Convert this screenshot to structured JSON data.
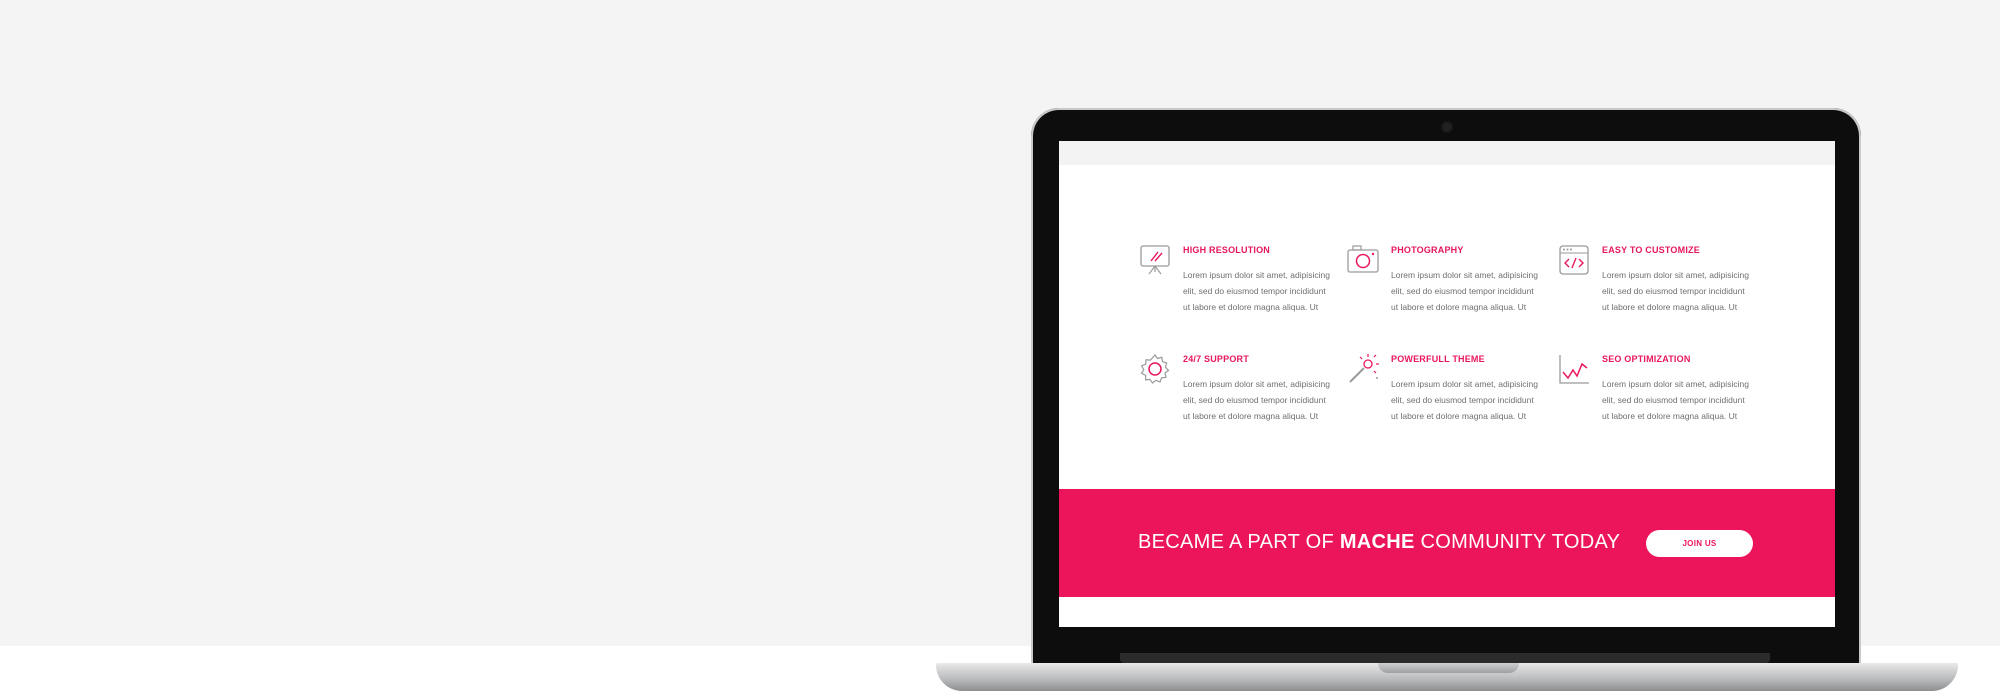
{
  "features": [
    {
      "title": "HIGH RESOLUTION",
      "desc": "Lorem ipsum dolor sit amet,  adipisicing elit, sed do eiusmod tempor incididunt ut labore et dolore magna aliqua. Ut",
      "icon": "presentation-board-icon"
    },
    {
      "title": "PHOTOGRAPHY",
      "desc": "Lorem ipsum dolor sit amet,  adipisicing elit, sed do eiusmod tempor incididunt ut labore et dolore magna aliqua. Ut",
      "icon": "camera-icon"
    },
    {
      "title": "EASY TO CUSTOMIZE",
      "desc": "Lorem ipsum dolor sit amet,  adipisicing elit, sed do eiusmod tempor incididunt ut labore et dolore magna aliqua. Ut",
      "icon": "code-window-icon"
    },
    {
      "title": "24/7 SUPPORT",
      "desc": "Lorem ipsum dolor sit amet,  adipisicing elit, sed do eiusmod tempor incididunt ut labore et dolore magna aliqua. Ut",
      "icon": "gear-icon"
    },
    {
      "title": "POWERFULL THEME",
      "desc": "Lorem ipsum dolor sit amet,  adipisicing elit, sed do eiusmod tempor incididunt ut labore et dolore magna aliqua. Ut",
      "icon": "magic-wand-icon"
    },
    {
      "title": "SEO OPTIMIZATION",
      "desc": "Lorem ipsum dolor sit amet,  adipisicing elit, sed do eiusmod tempor incididunt ut labore et dolore magna aliqua. Ut",
      "icon": "line-chart-icon"
    }
  ],
  "banner": {
    "text_before": "BECAME A PART OF ",
    "brand": "MACHE",
    "text_after": " COMMUNITY TODAY",
    "button_label": "JOIN US"
  },
  "colors": {
    "accent": "#ec145a",
    "text_muted": "#6f6f6f",
    "page_bg": "#f4f4f4"
  }
}
